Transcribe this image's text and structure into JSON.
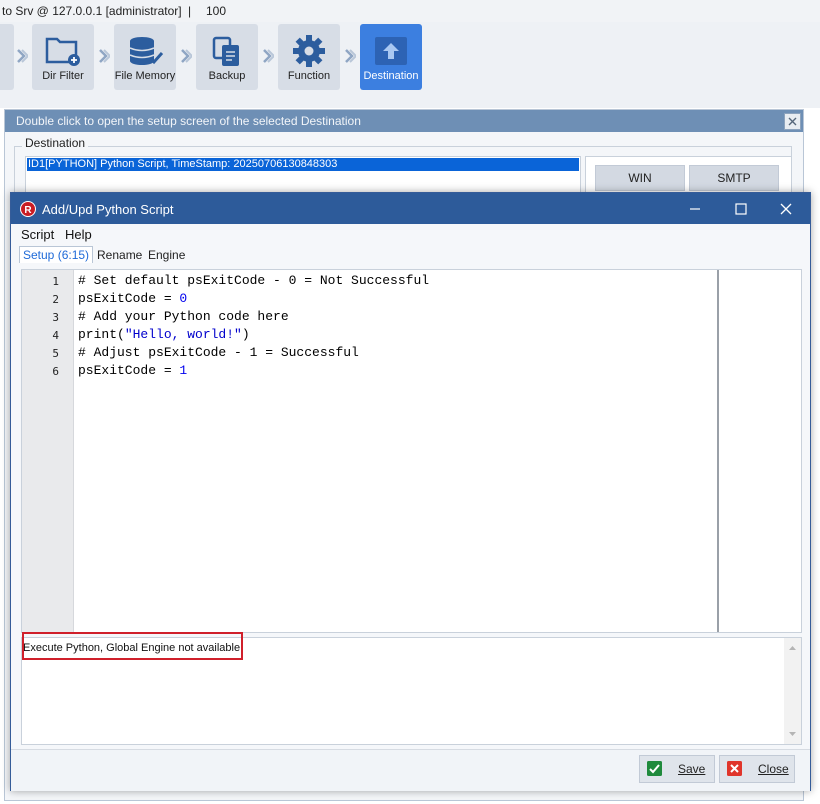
{
  "main_window": {
    "title_conn": "to Srv @ 127.0.0.1 [administrator]",
    "title_sep": "|",
    "title_num": "100"
  },
  "toolbar": {
    "steps": [
      {
        "label": "Dir Filter",
        "icon": "folder-plus-icon"
      },
      {
        "label": "File Memory",
        "icon": "database-check-icon"
      },
      {
        "label": "Backup",
        "icon": "documents-icon"
      },
      {
        "label": "Function",
        "icon": "gear-icon"
      },
      {
        "label": "Destination",
        "icon": "upload-icon"
      }
    ],
    "active_step": "Destination",
    "active_color": "#3c7fe0"
  },
  "destination_window": {
    "title": "Double click to open the setup screen of the selected Destination",
    "group_label": "Destination",
    "selected_item": "ID1[PYTHON] Python Script, TimeStamp: 20250706130848303",
    "buttons": [
      "WIN",
      "SMTP"
    ]
  },
  "dialog": {
    "title": "Add/Upd Python Script",
    "menu": [
      "Script",
      "Help"
    ],
    "tabs": [
      "Setup (6:15)",
      "Rename",
      "Engine"
    ],
    "selected_tab": "Setup (6:15)",
    "code_lines": [
      {
        "n": "1",
        "text": "# Set default psExitCode - 0 = Not Successful"
      },
      {
        "n": "2",
        "text": "psExitCode = 0"
      },
      {
        "n": "3",
        "text": "# Add your Python code here"
      },
      {
        "n": "4",
        "text": "print(\"Hello, world!\")"
      },
      {
        "n": "5",
        "text": "# Adjust psExitCode - 1 = Successful"
      },
      {
        "n": "6",
        "text": "psExitCode = 1"
      }
    ],
    "output_message": "Execute Python, Global Engine not available",
    "highlight_color": "#d0202b",
    "buttons": {
      "save": "Save",
      "close": "Close"
    }
  }
}
